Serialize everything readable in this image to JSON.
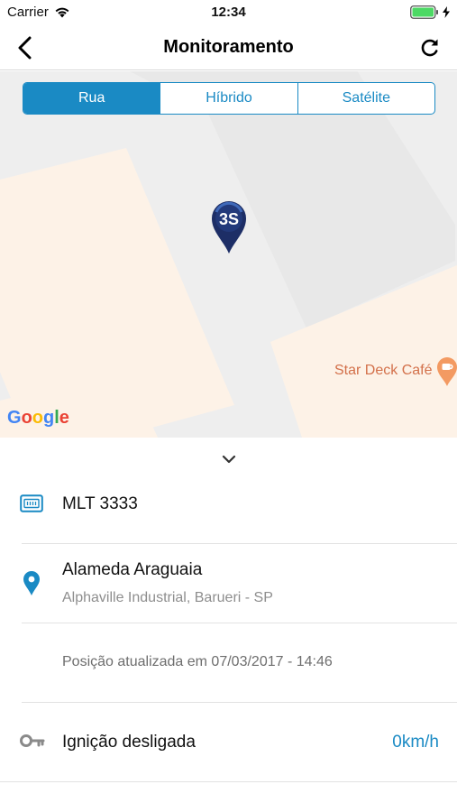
{
  "status_bar": {
    "carrier": "Carrier",
    "time": "12:34"
  },
  "nav": {
    "title": "Monitoramento"
  },
  "map": {
    "segments": [
      "Rua",
      "Híbrido",
      "Satélite"
    ],
    "selected_segment": "Rua",
    "poi_label": "Star Deck Café",
    "attribution": "Google",
    "marker_label": "3S"
  },
  "vehicle": {
    "plate": "MLT 3333",
    "street": "Alameda Araguaia",
    "area": "Alphaville Industrial, Barueri - SP",
    "updated": "Posição atualizada em 07/03/2017 - 14:46",
    "ignition": "Ignição desligada",
    "speed": "0km/h"
  },
  "colors": {
    "accent": "#1a8ac4",
    "map_block_light": "#fdf2e7",
    "map_road": "#eeeeee",
    "poi_orange": "#d3704a",
    "marker_navy": "#1d2e66"
  },
  "icons": [
    "back-arrow-icon",
    "refresh-icon",
    "wifi-icon",
    "battery-icon",
    "charging-bolt-icon",
    "map-marker-icon",
    "cafe-icon",
    "plate-icon",
    "location-pin-icon",
    "key-icon",
    "chevron-down-icon"
  ]
}
